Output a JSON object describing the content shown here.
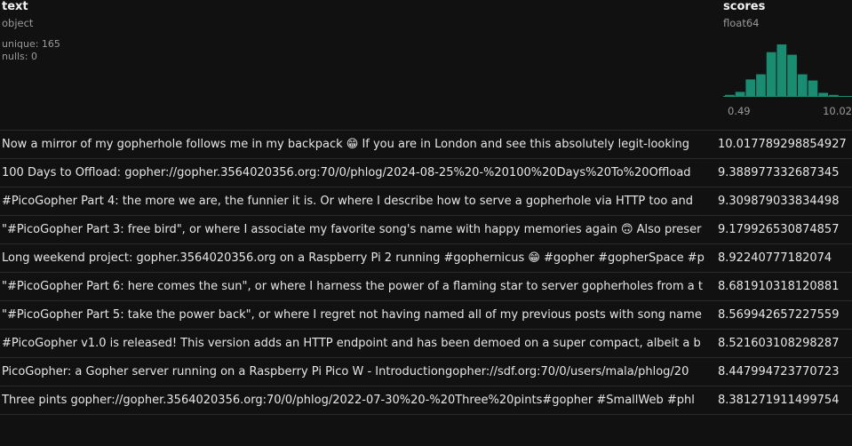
{
  "columns": {
    "text": {
      "name": "text",
      "dtype": "object",
      "stats": [
        "unique: 165",
        "nulls: 0"
      ]
    },
    "scores": {
      "name": "scores",
      "dtype": "float64",
      "hist_min_label": "0.49",
      "hist_max_label": "10.02"
    }
  },
  "histogram": {
    "color": "#1a8c72",
    "baseline_color": "#1a8c72",
    "relative_heights": [
      0.02,
      0.08,
      0.32,
      0.42,
      0.85,
      1.0,
      0.8,
      0.42,
      0.3,
      0.06,
      0.02
    ]
  },
  "rows": [
    {
      "text": "Now a mirror of my gopherhole follows me in my backpack 😁 If you are in London and see this absolutely legit-looking",
      "score": "10.017789298854927"
    },
    {
      "text": "100 Days to Offload: gopher://gopher.3564020356.org:70/0/phlog/2024-08-25%20-%20100%20Days%20To%20Offload",
      "score": "9.388977332687345"
    },
    {
      "text": "#PicoGopher Part 4: the more we are, the funnier it is. Or where I describe how to serve a gopherhole via HTTP too and",
      "score": "9.309879033834498"
    },
    {
      "text": "\"#PicoGopher Part 3: free bird\", or where I associate my favorite song's name with happy memories again 🙃 Also preser",
      "score": "9.179926530874857"
    },
    {
      "text": "Long weekend project: gopher.3564020356.org on a Raspberry Pi 2 running #gophernicus 😁 #gopher #gopherSpace #p",
      "score": "8.92240777182074"
    },
    {
      "text": "\"#PicoGopher Part 6: here comes the sun\", or where I harness the power of a flaming star to server gopherholes from a t",
      "score": "8.681910318120881"
    },
    {
      "text": "\"#PicoGopher Part 5: take the power back\", or where I regret not having named all of my previous posts with song name",
      "score": "8.569942657227559"
    },
    {
      "text": "#PicoGopher v1.0 is released! This version adds an HTTP endpoint and has been demoed on a super compact, albeit a b",
      "score": "8.521603108298287"
    },
    {
      "text": "PicoGopher: a Gopher server running on a Raspberry Pi Pico W - Introductiongopher://sdf.org:70/0/users/mala/phlog/20",
      "score": "8.447994723770723"
    },
    {
      "text": "Three pints gopher://gopher.3564020356.org:70/0/phlog/2022-07-30%20-%20Three%20pints#gopher #SmallWeb #phl",
      "score": "8.381271911499754"
    }
  ]
}
